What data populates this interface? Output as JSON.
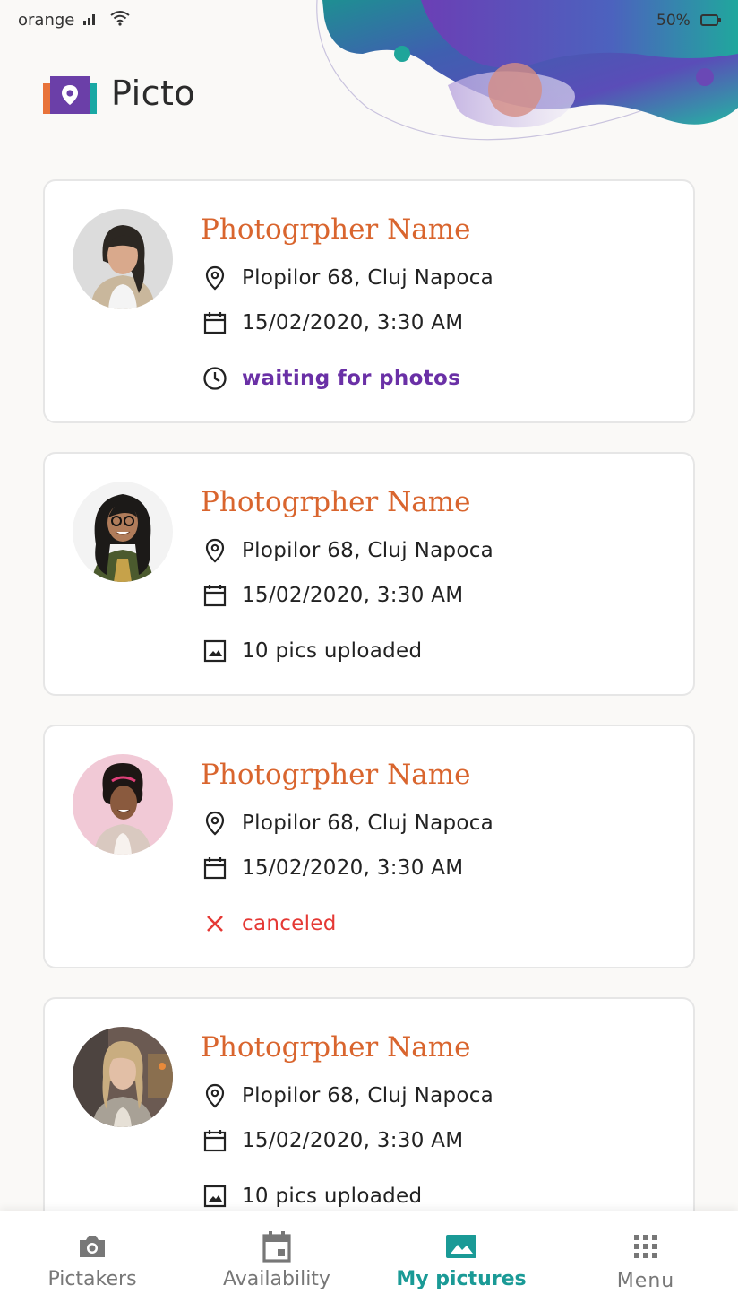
{
  "status_bar": {
    "carrier": "orange",
    "battery_percent": "50%"
  },
  "header": {
    "app_name": "Picto"
  },
  "colors": {
    "accent": "#d9652e",
    "waiting": "#6a30a6",
    "canceled": "#e53935",
    "nav_active": "#1a9a96"
  },
  "cards": [
    {
      "name": "Photogrpher Name",
      "address": "Plopilor 68, Cluj Napoca",
      "datetime": "15/02/2020, 3:30 AM",
      "status_icon": "clock-icon",
      "status": "waiting for photos"
    },
    {
      "name": "Photogrpher Name",
      "address": "Plopilor 68, Cluj Napoca",
      "datetime": "15/02/2020, 3:30 AM",
      "status_icon": "image-icon",
      "status": "10 pics uploaded"
    },
    {
      "name": "Photogrpher Name",
      "address": "Plopilor 68, Cluj Napoca",
      "datetime": "15/02/2020, 3:30 AM",
      "status_icon": "close-icon",
      "status": "canceled"
    },
    {
      "name": "Photogrpher Name",
      "address": "Plopilor 68, Cluj Napoca",
      "datetime": "15/02/2020, 3:30 AM",
      "status_icon": "image-icon",
      "status": "10 pics uploaded"
    }
  ],
  "bottom_nav": {
    "items": [
      {
        "label": "Pictakers",
        "icon": "camera-icon",
        "active": false
      },
      {
        "label": "Availability",
        "icon": "calendar-icon",
        "active": false
      },
      {
        "label": "My pictures",
        "icon": "photo-icon",
        "active": true
      },
      {
        "label": "Menu",
        "icon": "grid-icon",
        "active": false
      }
    ]
  }
}
